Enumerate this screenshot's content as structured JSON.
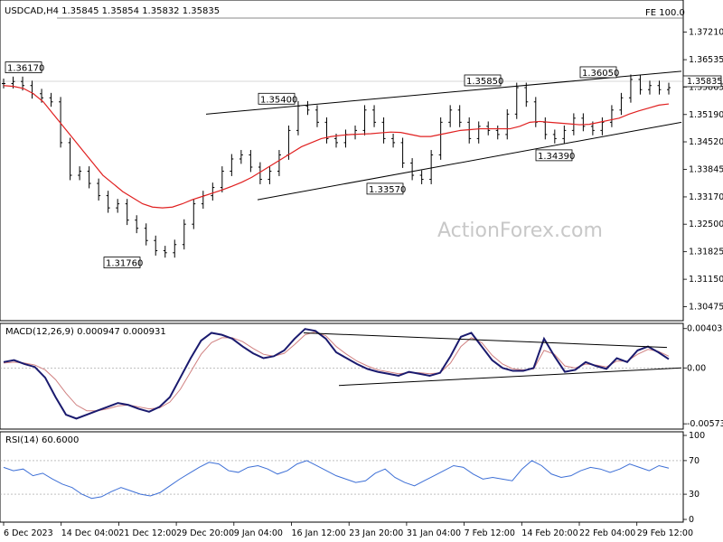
{
  "chart_data": {
    "type": "line",
    "symbol_line": "USDCAD,H4  1.35845 1.35854 1.35832 1.35835",
    "fe_label": "FE 100.0",
    "watermark": "ActionForex.com",
    "last_price": "1.35835",
    "ylim": [
      1.302,
      1.376
    ],
    "y_ticks": [
      "1.37210",
      "1.36535",
      "1.35865",
      "1.35190",
      "1.34520",
      "1.33845",
      "1.33170",
      "1.32500",
      "1.31825",
      "1.31150",
      "1.30475"
    ],
    "x_ticks": [
      "6 Dec 2023",
      "14 Dec 04:00",
      "21 Dec 12:00",
      "29 Dec 20:00",
      "9 Jan 04:00",
      "16 Jan 12:00",
      "23 Jan 20:00",
      "31 Jan 04:00",
      "7 Feb 12:00",
      "14 Feb 20:00",
      "22 Feb 04:00",
      "29 Feb 12:00"
    ],
    "annotations": [
      {
        "label": "1.36170",
        "price": 1.3617
      },
      {
        "label": "1.35400",
        "price": 1.354
      },
      {
        "label": "1.35850",
        "price": 1.3585
      },
      {
        "label": "1.36050",
        "price": 1.3605
      },
      {
        "label": "1.34390",
        "price": 1.3439
      },
      {
        "label": "1.33570",
        "price": 1.3357
      },
      {
        "label": "1.31760",
        "price": 1.3176
      }
    ],
    "price_series": [
      1.3595,
      1.36,
      1.359,
      1.357,
      1.356,
      1.355,
      1.345,
      1.337,
      1.338,
      1.335,
      1.332,
      1.329,
      1.33,
      1.326,
      1.324,
      1.321,
      1.3185,
      1.318,
      1.32,
      1.325,
      1.33,
      1.332,
      1.334,
      1.338,
      1.341,
      1.342,
      1.339,
      1.336,
      1.338,
      1.342,
      1.348,
      1.354,
      1.353,
      1.35,
      1.346,
      1.345,
      1.347,
      1.348,
      1.353,
      1.35,
      1.346,
      1.345,
      1.34,
      1.337,
      1.336,
      1.342,
      1.35,
      1.353,
      1.35,
      1.346,
      1.349,
      1.348,
      1.347,
      1.352,
      1.3585,
      1.355,
      1.35,
      1.347,
      1.346,
      1.348,
      1.351,
      1.349,
      1.348,
      1.35,
      1.353,
      1.356,
      1.3605,
      1.358,
      1.359,
      1.358,
      1.3585
    ],
    "sma_series": [
      1.359,
      1.3588,
      1.3583,
      1.357,
      1.355,
      1.352,
      1.349,
      1.346,
      1.343,
      1.34,
      1.337,
      1.335,
      1.333,
      1.3315,
      1.33,
      1.3292,
      1.329,
      1.3292,
      1.33,
      1.331,
      1.3318,
      1.3326,
      1.3334,
      1.3343,
      1.3353,
      1.3365,
      1.338,
      1.3395,
      1.341,
      1.3425,
      1.344,
      1.345,
      1.346,
      1.3465,
      1.3468,
      1.347,
      1.3471,
      1.3472,
      1.3474,
      1.3476,
      1.3475,
      1.347,
      1.3465,
      1.3465,
      1.347,
      1.3475,
      1.348,
      1.3482,
      1.3484,
      1.3484,
      1.3484,
      1.3484,
      1.349,
      1.35,
      1.3502,
      1.35,
      1.3498,
      1.3496,
      1.3494,
      1.3495,
      1.35,
      1.3505,
      1.351,
      1.352,
      1.3528,
      1.3535,
      1.3542,
      1.3545
    ],
    "channel_upper": [
      [
        1.352,
        1.3625
      ]
    ],
    "channel_lower": [
      [
        1.331,
        1.35
      ]
    ],
    "macd": {
      "label": "MACD(12,26,9) 0.000947 0.000931",
      "ylim": [
        -0.006,
        0.0042
      ],
      "y_ticks": [
        "0.004038",
        "0.00",
        "-0.005737"
      ],
      "series": [
        0.0006,
        0.0008,
        0.0004,
        0.0001,
        -0.001,
        -0.003,
        -0.0048,
        -0.0052,
        -0.0048,
        -0.0044,
        -0.004,
        -0.0036,
        -0.0038,
        -0.0042,
        -0.0045,
        -0.004,
        -0.003,
        -0.001,
        0.001,
        0.0028,
        0.0036,
        0.0034,
        0.003,
        0.0022,
        0.0015,
        0.001,
        0.0012,
        0.0018,
        0.003,
        0.004,
        0.0038,
        0.003,
        0.0016,
        0.001,
        0.0004,
        -0.0001,
        -0.0004,
        -0.0006,
        -0.0008,
        -0.0004,
        -0.0006,
        -0.0008,
        -0.0005,
        0.0012,
        0.0032,
        0.0036,
        0.0022,
        0.0008,
        0.0,
        -0.0003,
        -0.0003,
        0.0,
        0.003,
        0.0012,
        -0.0004,
        -0.0002,
        0.0006,
        0.0002,
        -0.0001,
        0.001,
        0.0006,
        0.0018,
        0.0022,
        0.0016,
        0.0009
      ],
      "signal": [
        0.0005,
        0.0006,
        0.0005,
        0.0003,
        -0.0002,
        -0.0012,
        -0.0026,
        -0.0038,
        -0.0044,
        -0.0044,
        -0.0042,
        -0.0039,
        -0.0038,
        -0.004,
        -0.0042,
        -0.0041,
        -0.0035,
        -0.0022,
        -0.0004,
        0.0014,
        0.0026,
        0.0031,
        0.0031,
        0.0027,
        0.002,
        0.0014,
        0.0012,
        0.0015,
        0.0024,
        0.0034,
        0.0037,
        0.0033,
        0.0022,
        0.0014,
        0.0007,
        0.0002,
        -0.0002,
        -0.0004,
        -0.0006,
        -0.0005,
        -0.0005,
        -0.0006,
        -0.0005,
        0.0005,
        0.0022,
        0.0031,
        0.0026,
        0.0013,
        0.0004,
        -0.0001,
        -0.0002,
        -0.0001,
        0.0018,
        0.0014,
        0.0002,
        0.0,
        0.0004,
        0.0003,
        0.0001,
        0.0007,
        0.0007,
        0.0014,
        0.0019,
        0.0017,
        0.0012
      ]
    },
    "rsi": {
      "label": "RSI(14) 60.6000",
      "ylim": [
        0,
        100
      ],
      "y_ticks": [
        "100",
        "70",
        "30",
        "0"
      ],
      "series": [
        62,
        58,
        60,
        52,
        55,
        48,
        42,
        38,
        30,
        25,
        27,
        33,
        38,
        34,
        30,
        28,
        32,
        40,
        48,
        55,
        62,
        68,
        66,
        58,
        56,
        62,
        64,
        60,
        54,
        58,
        66,
        70,
        64,
        58,
        52,
        48,
        44,
        46,
        55,
        60,
        50,
        44,
        40,
        46,
        52,
        58,
        64,
        62,
        54,
        48,
        50,
        48,
        46,
        60,
        70,
        64,
        54,
        50,
        52,
        58,
        62,
        60,
        56,
        60,
        66,
        62,
        58,
        64,
        61
      ]
    }
  }
}
